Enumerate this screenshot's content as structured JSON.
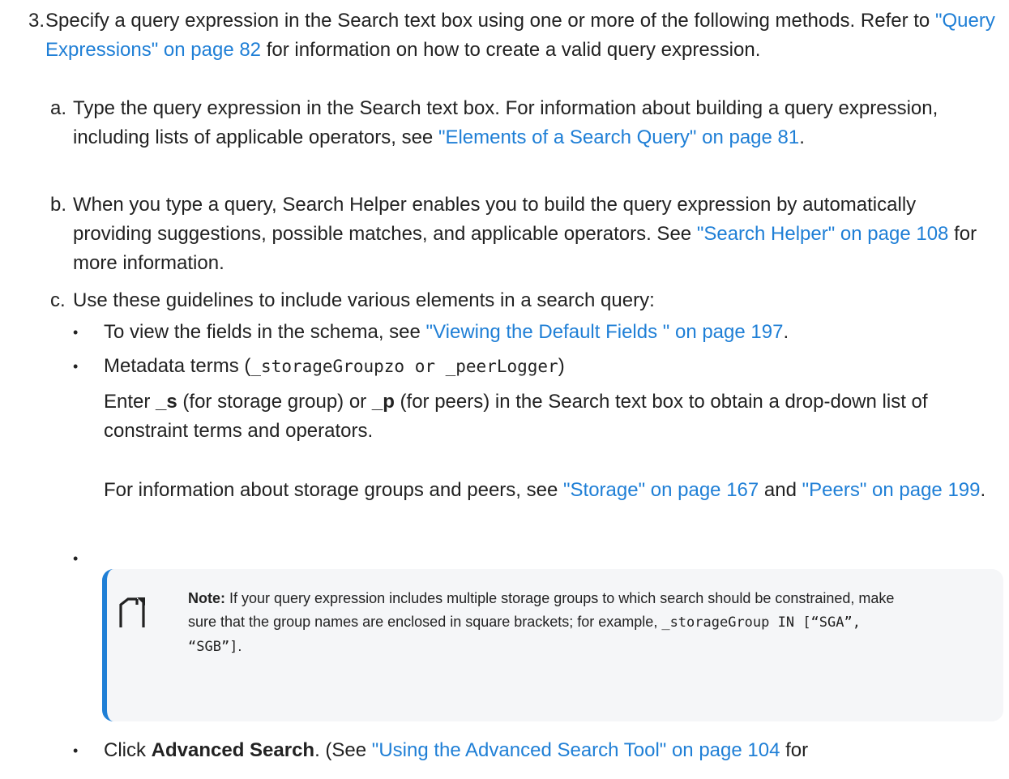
{
  "step3": {
    "number": "3.",
    "text_pre": "Specify a query expression in the Search text box using one or more of the following methods. Refer to ",
    "link": "\"Query Expressions\" on page 82",
    "text_post": " for information on how to create a valid query expression."
  },
  "sub_a": {
    "letter": "a.",
    "text_pre": "Type the query expression in the Search text box. For information about building a query expression, including lists of applicable operators, see ",
    "link": "\"Elements of a Search Query\" on page 81",
    "text_post": "."
  },
  "sub_b": {
    "letter": "b.",
    "text_pre": "When you type a query, Search Helper enables you to build the query expression by automatically providing suggestions, possible matches, and applicable operators. See ",
    "link": "\"Search Helper\" on page 108",
    "text_post": " for more information."
  },
  "sub_c": {
    "letter": "c.",
    "text": "Use these guidelines to include various elements in a search query:"
  },
  "bullet1": {
    "text_pre": "To view the fields in the schema, see ",
    "link": "\"Viewing the Default Fields \" on page 197",
    "text_post": "."
  },
  "bullet2": {
    "text_pre": "Metadata terms (",
    "code": "_storageGroupzo or _peerLogger",
    "text_post": ")",
    "para1_pre": "Enter ",
    "para1_b1": "_s",
    "para1_mid": " (for storage group) or ",
    "para1_b2": "_p",
    "para1_post": " (for peers) in the Search text box to obtain a drop-down list of constraint terms and operators.",
    "para2_pre": "For information about storage groups and peers, see ",
    "para2_link1": "\"Storage\" on page 167",
    "para2_mid": " and ",
    "para2_link2": "\"Peers\" on page 199",
    "para2_post": "."
  },
  "note": {
    "label": "Note:",
    "text_pre": " If your query expression includes multiple storage groups to which search should be constrained, make sure that the group names are enclosed in square brackets; for example, ",
    "code": "_storageGroup IN [“SGA”, “SGB”]",
    "text_post": "."
  },
  "bullet4": {
    "text_pre": "Click ",
    "bold": "Advanced Search",
    "text_mid": ". (See ",
    "link": "\"Using the Advanced Search Tool\" on page 104",
    "text_post": " for"
  },
  "bullet_char": "•",
  "colors": {
    "link": "#1f7fd6",
    "note_accent": "#1f7fd6",
    "note_bg": "#f5f6f8"
  },
  "icons": {
    "note": "note-page-icon"
  }
}
